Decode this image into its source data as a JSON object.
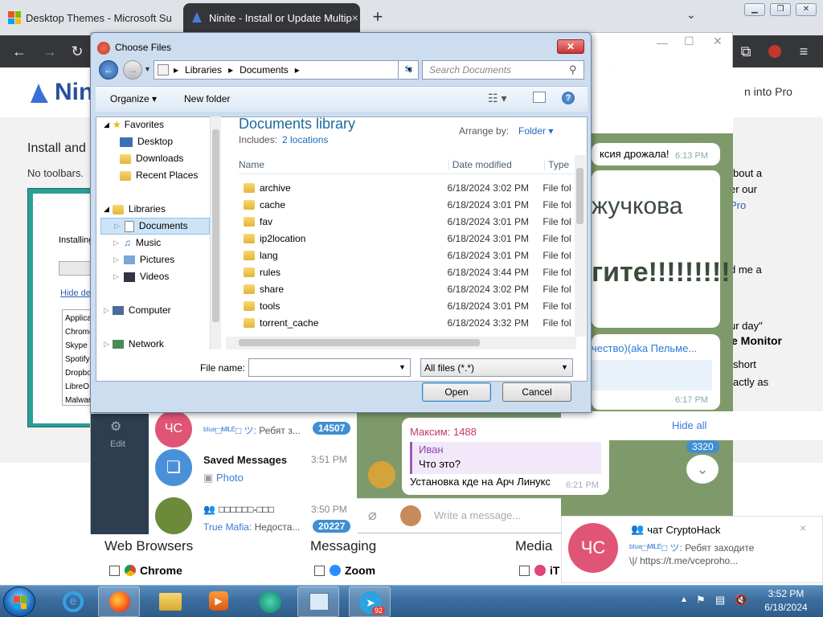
{
  "browser": {
    "tabs": [
      {
        "title": "Desktop Themes - Microsoft Su",
        "active": false
      },
      {
        "title": "Ninite - Install or Update Multip",
        "active": true
      }
    ],
    "new_tab_label": "+",
    "tab_search_icon": "chevron-down-icon",
    "accent": "#35363a"
  },
  "ninite": {
    "logo_text": "Nini",
    "header_right": "n into Pro",
    "install_heading": "Install and",
    "subline": "No toolbars.",
    "right_texts": [
      "bout a",
      "er our",
      "Pro",
      "d me a",
      "ur day\"",
      "e Monitor",
      "short",
      "actly as"
    ],
    "installer": {
      "status": "Installing",
      "link": "Hide de",
      "apps": [
        "Applica",
        "Chrome",
        "Skype",
        "Spotify",
        "Dropbo",
        "LibreO",
        "Malwar"
      ]
    },
    "sections": [
      {
        "title": "Web Browsers",
        "item": "Chrome"
      },
      {
        "title": "Messaging",
        "item": "Zoom"
      },
      {
        "title": "Media",
        "item": "iT"
      }
    ]
  },
  "telegram": {
    "edit_label": "Edit",
    "chats": [
      {
        "avatar": "ЧС",
        "avatar_color": "#e05575",
        "name": "",
        "preview_sender": "ᵇˡᵘᵉ□ᴹᴵᴸᴱ□ ツ:",
        "preview": "Ребят з...",
        "badge": "14507",
        "time": ""
      },
      {
        "avatar": "",
        "avatar_color": "#4a90d9",
        "name": "Saved Messages",
        "preview_sender": "",
        "preview": "Photo",
        "badge": "",
        "time": "3:51 PM"
      },
      {
        "avatar": "",
        "avatar_color": "#6b8a3a",
        "name": "□□□□□□-□□□",
        "preview_sender": "True Mafia:",
        "preview": "Недоста...",
        "badge": "20227",
        "time": "3:50 PM"
      }
    ],
    "messages": {
      "m1": "ксия дрожала!",
      "m1_time": "6:13 PM",
      "sticker1": "жучкова",
      "sticker2": "гите!!!!!!!!!",
      "link_text": "чество)(aka Пельме...",
      "m2_time": "6:17 PM",
      "reply_sender": "Максим: 1488",
      "reply_name": "Иван",
      "reply_text": "Что это?",
      "reply_body": "Установка кде на Арч Линукс",
      "reply_time": "6:21 PM"
    },
    "scroll_badge": "3320",
    "input_placeholder": "Write a message...",
    "hide_all": "Hide all",
    "notification": {
      "avatar": "ЧС",
      "title": "чат CryptoHack",
      "sender": "ᵇˡᵘᵉ□ᴹᴵᴸᴱ□ ツ:",
      "text": "Ребят заходите",
      "text2": "\\|/ https://t.me/vceproho...",
      "close": "×"
    }
  },
  "dialog": {
    "title": "Choose Files",
    "breadcrumb": [
      "Libraries",
      "Documents"
    ],
    "search_placeholder": "Search Documents",
    "organize": "Organize",
    "new_folder": "New folder",
    "library_title": "Documents library",
    "includes_label": "Includes:",
    "includes_link": "2 locations",
    "arrange_label": "Arrange by:",
    "arrange_value": "Folder",
    "nav": {
      "favorites": "Favorites",
      "fav_items": [
        "Desktop",
        "Downloads",
        "Recent Places"
      ],
      "libraries": "Libraries",
      "lib_items": [
        "Documents",
        "Music",
        "Pictures",
        "Videos"
      ],
      "computer": "Computer",
      "network": "Network"
    },
    "columns": [
      "Name",
      "Date modified",
      "Type"
    ],
    "files": [
      {
        "name": "archive",
        "date": "6/18/2024 3:02 PM",
        "type": "File fol"
      },
      {
        "name": "cache",
        "date": "6/18/2024 3:01 PM",
        "type": "File fol"
      },
      {
        "name": "fav",
        "date": "6/18/2024 3:01 PM",
        "type": "File fol"
      },
      {
        "name": "ip2location",
        "date": "6/18/2024 3:01 PM",
        "type": "File fol"
      },
      {
        "name": "lang",
        "date": "6/18/2024 3:01 PM",
        "type": "File fol"
      },
      {
        "name": "rules",
        "date": "6/18/2024 3:44 PM",
        "type": "File fol"
      },
      {
        "name": "share",
        "date": "6/18/2024 3:02 PM",
        "type": "File fol"
      },
      {
        "name": "tools",
        "date": "6/18/2024 3:01 PM",
        "type": "File fol"
      },
      {
        "name": "torrent_cache",
        "date": "6/18/2024 3:32 PM",
        "type": "File fol"
      }
    ],
    "file_name_label": "File name:",
    "file_name_value": "",
    "filter_value": "All files (*.*)",
    "open_label": "Open",
    "cancel_label": "Cancel"
  },
  "taskbar": {
    "time": "3:52 PM",
    "date": "6/18/2024",
    "telegram_badge": "92"
  }
}
